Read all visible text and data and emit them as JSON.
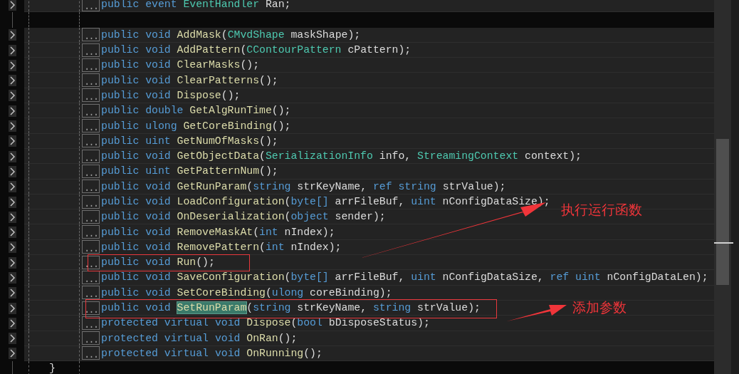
{
  "editor": {
    "lines": [
      {
        "kind": "member",
        "fold": "...",
        "tokens": [
          {
            "kind": "keyword",
            "text": "public"
          },
          {
            "kind": "keyword",
            "text": "event"
          },
          {
            "kind": "type",
            "text": "EventHandler"
          },
          {
            "kind": "plain",
            "text": "Ran;"
          }
        ]
      },
      {
        "kind": "blank"
      },
      {
        "kind": "member",
        "fold": "...",
        "tokens": [
          {
            "kind": "keyword",
            "text": "public"
          },
          {
            "kind": "keyword",
            "text": "void"
          },
          {
            "kind": "method",
            "text": "AddMask"
          },
          {
            "kind": "plain",
            "text": "("
          },
          {
            "kind": "type",
            "text": "CMvdShape"
          },
          {
            "kind": "plain",
            "text": "maskShape);"
          }
        ]
      },
      {
        "kind": "member",
        "fold": "...",
        "tokens": [
          {
            "kind": "keyword",
            "text": "public"
          },
          {
            "kind": "keyword",
            "text": "void"
          },
          {
            "kind": "method",
            "text": "AddPattern"
          },
          {
            "kind": "plain",
            "text": "("
          },
          {
            "kind": "type",
            "text": "CContourPattern"
          },
          {
            "kind": "plain",
            "text": "cPattern);"
          }
        ]
      },
      {
        "kind": "member",
        "fold": "...",
        "tokens": [
          {
            "kind": "keyword",
            "text": "public"
          },
          {
            "kind": "keyword",
            "text": "void"
          },
          {
            "kind": "method",
            "text": "ClearMasks"
          },
          {
            "kind": "plain",
            "text": "();"
          }
        ]
      },
      {
        "kind": "member",
        "fold": "...",
        "tokens": [
          {
            "kind": "keyword",
            "text": "public"
          },
          {
            "kind": "keyword",
            "text": "void"
          },
          {
            "kind": "method",
            "text": "ClearPatterns"
          },
          {
            "kind": "plain",
            "text": "();"
          }
        ]
      },
      {
        "kind": "member",
        "fold": "...",
        "tokens": [
          {
            "kind": "keyword",
            "text": "public"
          },
          {
            "kind": "keyword",
            "text": "void"
          },
          {
            "kind": "method",
            "text": "Dispose"
          },
          {
            "kind": "plain",
            "text": "();"
          }
        ]
      },
      {
        "kind": "member",
        "fold": "...",
        "tokens": [
          {
            "kind": "keyword",
            "text": "public"
          },
          {
            "kind": "keyword",
            "text": "double"
          },
          {
            "kind": "method",
            "text": "GetAlgRunTime"
          },
          {
            "kind": "plain",
            "text": "();"
          }
        ]
      },
      {
        "kind": "member",
        "fold": "...",
        "tokens": [
          {
            "kind": "keyword",
            "text": "public"
          },
          {
            "kind": "keyword",
            "text": "ulong"
          },
          {
            "kind": "method",
            "text": "GetCoreBinding"
          },
          {
            "kind": "plain",
            "text": "();"
          }
        ]
      },
      {
        "kind": "member",
        "fold": "...",
        "tokens": [
          {
            "kind": "keyword",
            "text": "public"
          },
          {
            "kind": "keyword",
            "text": "uint"
          },
          {
            "kind": "method",
            "text": "GetNumOfMasks"
          },
          {
            "kind": "plain",
            "text": "();"
          }
        ]
      },
      {
        "kind": "member",
        "fold": "...",
        "tokens": [
          {
            "kind": "keyword",
            "text": "public"
          },
          {
            "kind": "keyword",
            "text": "void"
          },
          {
            "kind": "method",
            "text": "GetObjectData"
          },
          {
            "kind": "plain",
            "text": "("
          },
          {
            "kind": "type",
            "text": "SerializationInfo"
          },
          {
            "kind": "plain",
            "text": "info,"
          },
          {
            "kind": "type",
            "text": "StreamingContext"
          },
          {
            "kind": "plain",
            "text": "context);"
          }
        ]
      },
      {
        "kind": "member",
        "fold": "...",
        "tokens": [
          {
            "kind": "keyword",
            "text": "public"
          },
          {
            "kind": "keyword",
            "text": "uint"
          },
          {
            "kind": "method",
            "text": "GetPatternNum"
          },
          {
            "kind": "plain",
            "text": "();"
          }
        ]
      },
      {
        "kind": "member",
        "fold": "...",
        "tokens": [
          {
            "kind": "keyword",
            "text": "public"
          },
          {
            "kind": "keyword",
            "text": "void"
          },
          {
            "kind": "method",
            "text": "GetRunParam"
          },
          {
            "kind": "plain",
            "text": "("
          },
          {
            "kind": "keyword",
            "text": "string"
          },
          {
            "kind": "plain",
            "text": "strKeyName,"
          },
          {
            "kind": "keyword",
            "text": "ref"
          },
          {
            "kind": "keyword",
            "text": "string"
          },
          {
            "kind": "plain",
            "text": "strValue);"
          }
        ]
      },
      {
        "kind": "member",
        "fold": "...",
        "tokens": [
          {
            "kind": "keyword",
            "text": "public"
          },
          {
            "kind": "keyword",
            "text": "void"
          },
          {
            "kind": "method",
            "text": "LoadConfiguration"
          },
          {
            "kind": "plain",
            "text": "("
          },
          {
            "kind": "keyword",
            "text": "byte[]"
          },
          {
            "kind": "plain",
            "text": "arrFileBuf,"
          },
          {
            "kind": "keyword",
            "text": "uint"
          },
          {
            "kind": "plain",
            "text": "nConfigDataSize);"
          }
        ]
      },
      {
        "kind": "member",
        "fold": "...",
        "tokens": [
          {
            "kind": "keyword",
            "text": "public"
          },
          {
            "kind": "keyword",
            "text": "void"
          },
          {
            "kind": "method",
            "text": "OnDeserialization"
          },
          {
            "kind": "plain",
            "text": "("
          },
          {
            "kind": "keyword",
            "text": "object"
          },
          {
            "kind": "plain",
            "text": "sender);"
          }
        ]
      },
      {
        "kind": "member",
        "fold": "...",
        "tokens": [
          {
            "kind": "keyword",
            "text": "public"
          },
          {
            "kind": "keyword",
            "text": "void"
          },
          {
            "kind": "method",
            "text": "RemoveMaskAt"
          },
          {
            "kind": "plain",
            "text": "("
          },
          {
            "kind": "keyword",
            "text": "int"
          },
          {
            "kind": "plain",
            "text": "nIndex);"
          }
        ]
      },
      {
        "kind": "member",
        "fold": "...",
        "tokens": [
          {
            "kind": "keyword",
            "text": "public"
          },
          {
            "kind": "keyword",
            "text": "void"
          },
          {
            "kind": "method",
            "text": "RemovePattern"
          },
          {
            "kind": "plain",
            "text": "("
          },
          {
            "kind": "keyword",
            "text": "int"
          },
          {
            "kind": "plain",
            "text": "nIndex);"
          }
        ]
      },
      {
        "kind": "member",
        "fold": "...",
        "tokens": [
          {
            "kind": "keyword",
            "text": "public"
          },
          {
            "kind": "keyword",
            "text": "void"
          },
          {
            "kind": "method",
            "text": "Run"
          },
          {
            "kind": "plain",
            "text": "();"
          }
        ]
      },
      {
        "kind": "member",
        "fold": "...",
        "tokens": [
          {
            "kind": "keyword",
            "text": "public"
          },
          {
            "kind": "keyword",
            "text": "void"
          },
          {
            "kind": "method",
            "text": "SaveConfiguration"
          },
          {
            "kind": "plain",
            "text": "("
          },
          {
            "kind": "keyword",
            "text": "byte[]"
          },
          {
            "kind": "plain",
            "text": "arrFileBuf,"
          },
          {
            "kind": "keyword",
            "text": "uint"
          },
          {
            "kind": "plain",
            "text": "nConfigDataSize,"
          },
          {
            "kind": "keyword",
            "text": "ref"
          },
          {
            "kind": "keyword",
            "text": "uint"
          },
          {
            "kind": "plain",
            "text": "nConfigDataLen);"
          }
        ]
      },
      {
        "kind": "member",
        "fold": "...",
        "tokens": [
          {
            "kind": "keyword",
            "text": "public"
          },
          {
            "kind": "keyword",
            "text": "void"
          },
          {
            "kind": "method",
            "text": "SetCoreBinding"
          },
          {
            "kind": "plain",
            "text": "("
          },
          {
            "kind": "keyword",
            "text": "ulong"
          },
          {
            "kind": "plain",
            "text": "coreBinding);"
          }
        ]
      },
      {
        "kind": "member",
        "fold": "...",
        "tokens": [
          {
            "kind": "keyword",
            "text": "public"
          },
          {
            "kind": "keyword",
            "text": "void"
          },
          {
            "kind": "match",
            "text": "SetRunParam"
          },
          {
            "kind": "plain",
            "text": "("
          },
          {
            "kind": "keyword",
            "text": "string"
          },
          {
            "kind": "plain",
            "text": "strKeyName,"
          },
          {
            "kind": "keyword",
            "text": "string"
          },
          {
            "kind": "plain",
            "text": "strValue);"
          }
        ]
      },
      {
        "kind": "member",
        "fold": "...",
        "tokens": [
          {
            "kind": "keyword",
            "text": "protected"
          },
          {
            "kind": "keyword",
            "text": "virtual"
          },
          {
            "kind": "keyword",
            "text": "void"
          },
          {
            "kind": "method",
            "text": "Dispose"
          },
          {
            "kind": "plain",
            "text": "("
          },
          {
            "kind": "keyword",
            "text": "bool"
          },
          {
            "kind": "plain",
            "text": "bDisposeStatus);"
          }
        ]
      },
      {
        "kind": "member",
        "fold": "...",
        "tokens": [
          {
            "kind": "keyword",
            "text": "protected"
          },
          {
            "kind": "keyword",
            "text": "virtual"
          },
          {
            "kind": "keyword",
            "text": "void"
          },
          {
            "kind": "method",
            "text": "OnRan"
          },
          {
            "kind": "plain",
            "text": "();"
          }
        ]
      },
      {
        "kind": "member",
        "fold": "...",
        "tokens": [
          {
            "kind": "keyword",
            "text": "protected"
          },
          {
            "kind": "keyword",
            "text": "virtual"
          },
          {
            "kind": "keyword",
            "text": "void"
          },
          {
            "kind": "method",
            "text": "OnRunning"
          },
          {
            "kind": "plain",
            "text": "();"
          }
        ]
      },
      {
        "kind": "brace",
        "text": "}"
      }
    ]
  },
  "annotations": [
    {
      "kind": "box"
    },
    {
      "kind": "box"
    },
    {
      "kind": "note",
      "text": "执行运行函数"
    },
    {
      "kind": "note",
      "text": "添加参数"
    }
  ]
}
